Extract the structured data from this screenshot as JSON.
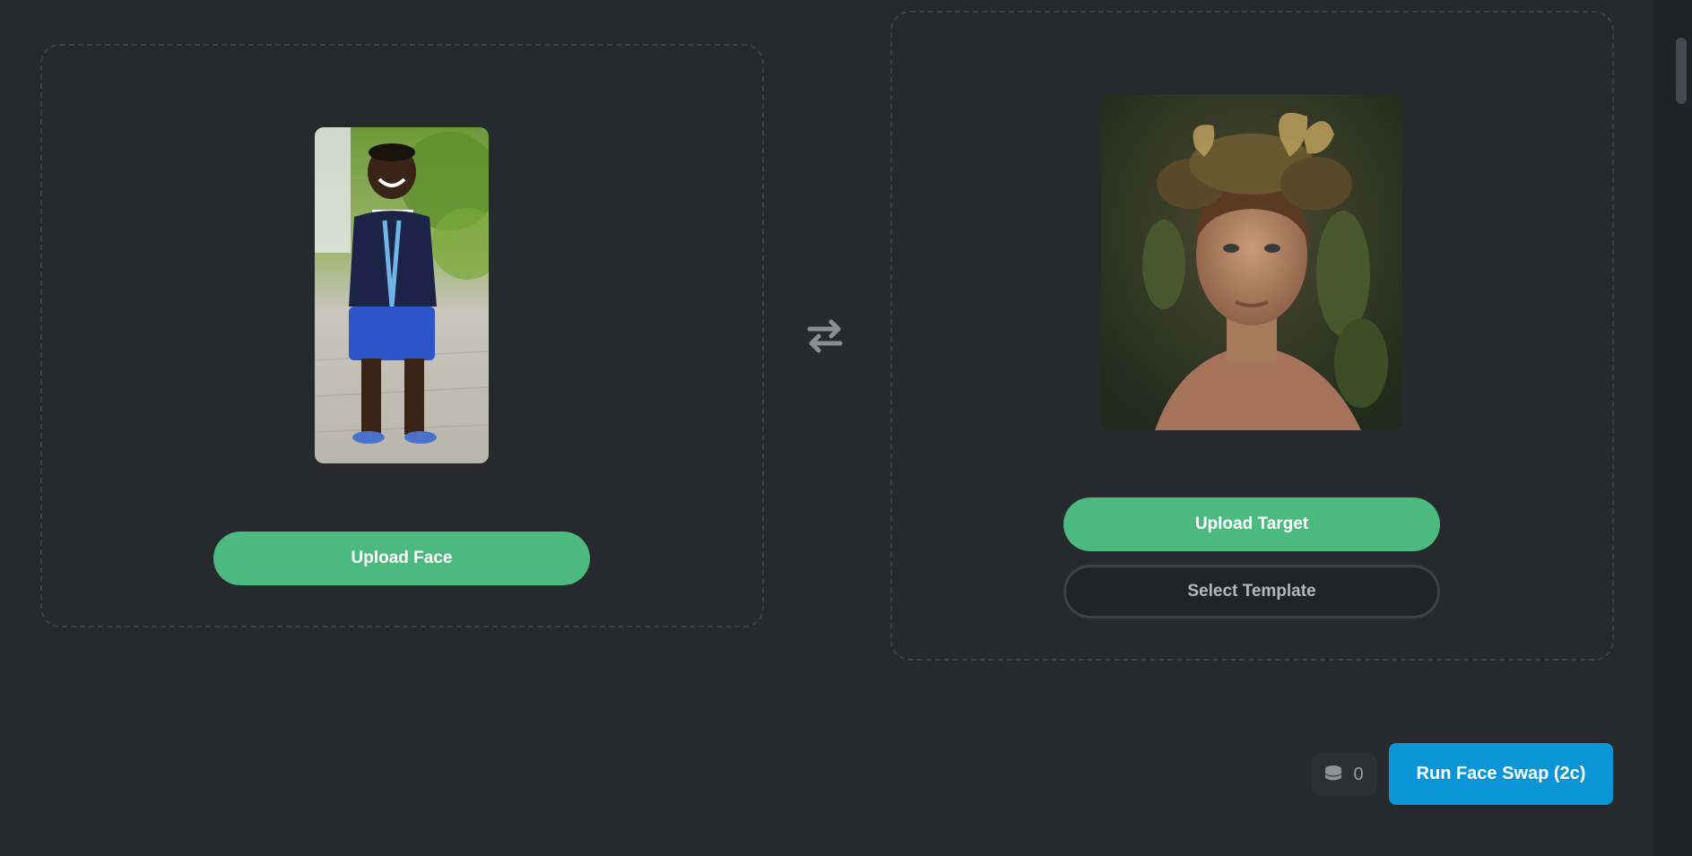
{
  "face_panel": {
    "upload_label": "Upload Face",
    "image_alt": "Smiling child in navy cardigan and blue shorts"
  },
  "swap_icon": "arrows-swap-icon",
  "target_panel": {
    "upload_label": "Upload Target",
    "template_label": "Select Template",
    "image_alt": "Young man wearing a leafy crown with butterflies"
  },
  "footer": {
    "credits_icon": "coins-stack-icon",
    "credits_count": "0",
    "run_label": "Run Face Swap (2c)"
  },
  "colors": {
    "background": "#26292e",
    "primary_green": "#4cba7f",
    "run_blue": "#0a96d6"
  }
}
